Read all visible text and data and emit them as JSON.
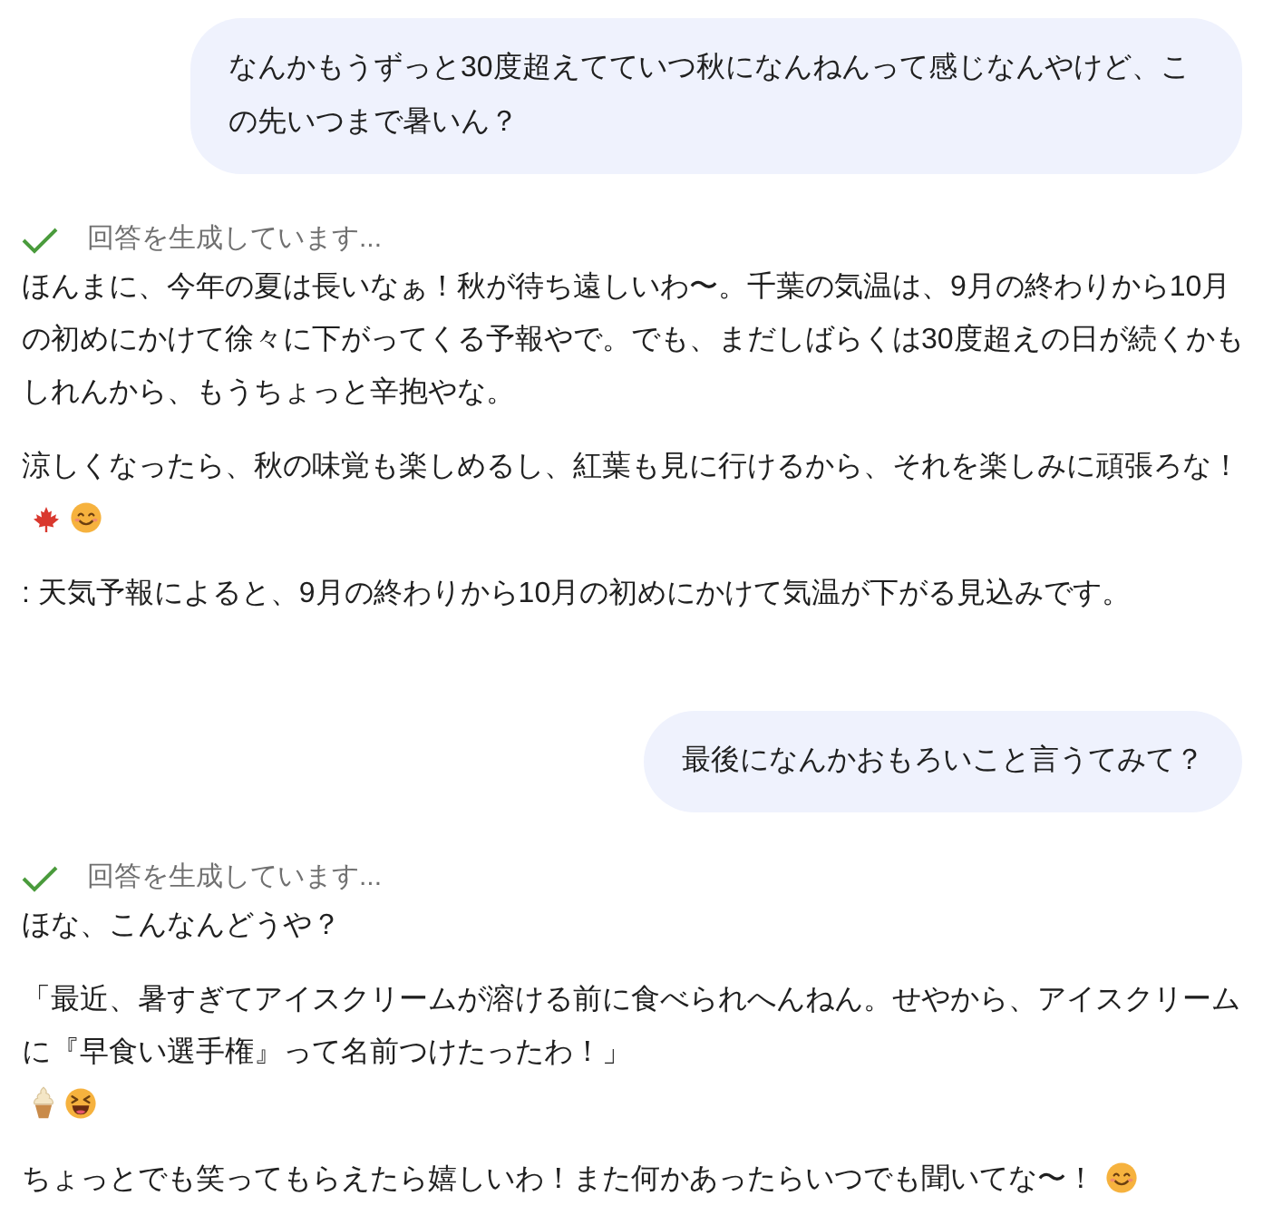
{
  "messages": [
    {
      "kind": "user",
      "text": "なんかもうずっと30度超えてていつ秋になんねんって感じなんやけど、この先いつまで暑いん？"
    },
    {
      "kind": "assistant",
      "status": "回答を生成しています...",
      "paragraphs": [
        {
          "text": "ほんまに、今年の夏は長いなぁ！秋が待ち遠しいわ〜。千葉の気温は、9月の終わりから10月の初めにかけて徐々に下がってくる予報やで。でも、まだしばらくは30度超えの日が続くかもしれんから、もうちょっと辛抱やな。"
        },
        {
          "text": "涼しくなったら、秋の味覚も楽しめるし、紅葉も見に行けるから、それを楽しみに頑張ろな！",
          "emojis": [
            {
              "kind": "maple"
            },
            {
              "kind": "smile"
            }
          ]
        },
        {
          "text": ": 天気予報によると、9月の終わりから10月の初めにかけて気温が下がる見込みです。"
        }
      ]
    },
    {
      "kind": "user",
      "text": "最後になんかおもろいこと言うてみて？"
    },
    {
      "kind": "assistant",
      "status": "回答を生成しています...",
      "paragraphs": [
        {
          "text": "ほな、こんなんどうや？"
        },
        {
          "text": "「最近、暑すぎてアイスクリームが溶ける前に食べられへんねん。せやから、アイスクリームに『早食い選手権』って名前つけたったわ！」",
          "emojis": [
            {
              "kind": "icecream"
            },
            {
              "kind": "laugh"
            }
          ]
        },
        {
          "text": "ちょっとでも笑ってもらえたら嬉しいわ！また何かあったらいつでも聞いてな〜！",
          "emojis": [
            {
              "kind": "smile"
            }
          ]
        }
      ]
    }
  ]
}
